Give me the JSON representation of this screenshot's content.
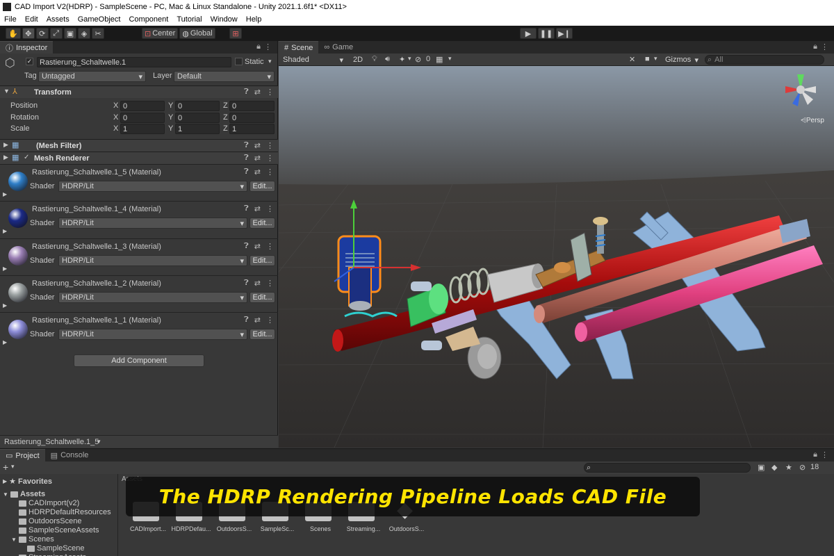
{
  "window": {
    "title": "CAD Import V2(HDRP) - SampleScene - PC, Mac & Linux Standalone - Unity 2021.1.6f1* <DX11>"
  },
  "menu": [
    "File",
    "Edit",
    "Assets",
    "GameObject",
    "Component",
    "Tutorial",
    "Window",
    "Help"
  ],
  "toolbar": {
    "pivot_label": "Center",
    "space_label": "Global"
  },
  "inspector": {
    "tab_label": "Inspector",
    "object_name": "Rastierung_Schaltwelle.1",
    "static_label": "Static",
    "tag_label": "Tag",
    "tag_value": "Untagged",
    "layer_label": "Layer",
    "layer_value": "Default",
    "transform": {
      "title": "Transform",
      "position_label": "Position",
      "rotation_label": "Rotation",
      "scale_label": "Scale",
      "position": {
        "x": "0",
        "y": "0",
        "z": "0"
      },
      "rotation": {
        "x": "0",
        "y": "0",
        "z": "0"
      },
      "scale": {
        "x": "1",
        "y": "1",
        "z": "1"
      }
    },
    "mesh_filter_title": "(Mesh Filter)",
    "mesh_renderer_title": "Mesh Renderer",
    "shader_label": "Shader",
    "edit_label": "Edit...",
    "materials": [
      {
        "name": "Rastierung_Schaltwelle.1_5 (Material)",
        "shader": "HDRP/Lit",
        "color": "#2f7fc8"
      },
      {
        "name": "Rastierung_Schaltwelle.1_4 (Material)",
        "shader": "HDRP/Lit",
        "color": "#1b2a86"
      },
      {
        "name": "Rastierung_Schaltwelle.1_3 (Material)",
        "shader": "HDRP/Lit",
        "color": "#9b7fb5"
      },
      {
        "name": "Rastierung_Schaltwelle.1_2 (Material)",
        "shader": "HDRP/Lit",
        "color": "#9aa0a0"
      },
      {
        "name": "Rastierung_Schaltwelle.1_1 (Material)",
        "shader": "HDRP/Lit",
        "color": "#8c8cd8"
      }
    ],
    "add_component_label": "Add Component",
    "footer_selection": "Rastierung_Schaltwelle.1_5"
  },
  "scene": {
    "scene_tab": "Scene",
    "game_tab": "Game",
    "shading_mode": "Shaded",
    "mode_2d": "2D",
    "hidden_count": "0",
    "gizmos_label": "Gizmos",
    "search_placeholder": "All",
    "persp_label": "Persp"
  },
  "bottom": {
    "project_tab": "Project",
    "console_tab": "Console",
    "hidden_count": "18",
    "favorites_label": "Favorites",
    "assets_header": "Assets",
    "tree": [
      {
        "label": "Assets",
        "depth": 0
      },
      {
        "label": "CADImport(v2)",
        "depth": 1
      },
      {
        "label": "HDRPDefaultResources",
        "depth": 1
      },
      {
        "label": "OutdoorsScene",
        "depth": 1
      },
      {
        "label": "SampleSceneAssets",
        "depth": 1
      },
      {
        "label": "Scenes",
        "depth": 1
      },
      {
        "label": "SampleScene",
        "depth": 2
      },
      {
        "label": "StreamingAssets",
        "depth": 1
      }
    ],
    "assets": [
      "CADImport...",
      "HDRPDefau...",
      "OutdoorsS...",
      "SampleSc...",
      "Scenes",
      "Streaming...",
      "OutdoorsS..."
    ]
  },
  "caption": "The HDRP Rendering Pipeline Loads CAD File"
}
